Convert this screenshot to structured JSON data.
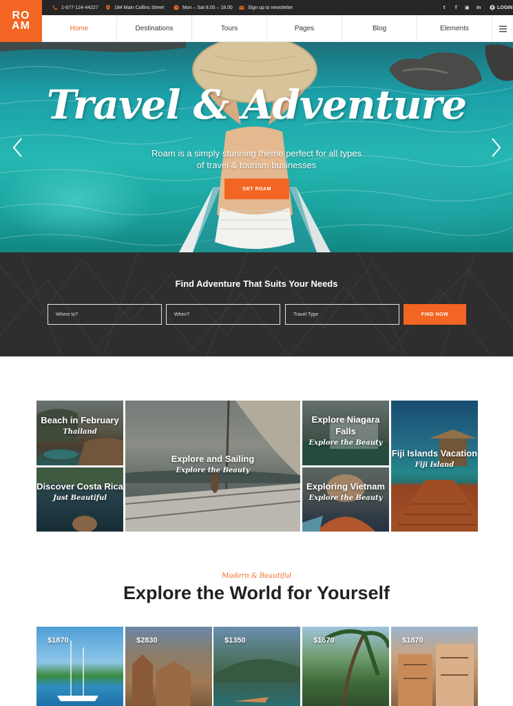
{
  "topbar": {
    "phone": "1-677-124-44227",
    "address": "184 Main Collins Street",
    "hours": "Mon – Sat 8.00 – 18.00",
    "newsletter": "Sign up to newsletter",
    "social": [
      "twitter-icon",
      "facebook-icon",
      "instagram-icon",
      "linkedin-icon"
    ],
    "social_glyphs": [
      "t",
      "f",
      "▣",
      "in"
    ],
    "login": "LOGIN"
  },
  "logo": {
    "line1": "RO",
    "line2": "AM"
  },
  "nav": {
    "items": [
      "Home",
      "Destinations",
      "Tours",
      "Pages",
      "Blog",
      "Elements"
    ],
    "active": "Home"
  },
  "hero": {
    "title": "Travel & Adventure",
    "subtitle": "Roam is a simply stunning theme perfect for all types of travel & tourism businesses",
    "button": "GET ROAM"
  },
  "search": {
    "title": "Find Adventure That Suits Your Needs",
    "where_placeholder": "Where to?",
    "when_placeholder": "When?",
    "type_placeholder": "Travel Type",
    "button": "FIND NOW"
  },
  "destinations": [
    {
      "title": "Beach in February",
      "subtitle": "Thailand"
    },
    {
      "title": "Discover Costa Rica",
      "subtitle": "Just Beautiful"
    },
    {
      "title": "Explore and Sailing",
      "subtitle": "Explore the Beauty"
    },
    {
      "title": "Explore Niagara Falls",
      "subtitle": "Explore the Beauty"
    },
    {
      "title": "Exploring Vietnam",
      "subtitle": "Explore the Beauty"
    },
    {
      "title": "Fiji Islands Vacation",
      "subtitle": "Fiji Island"
    }
  ],
  "explore": {
    "kicker": "Modern & Beautiful",
    "heading": "Explore the World for Yourself"
  },
  "tours": [
    {
      "price": "$1870"
    },
    {
      "price": "$2830"
    },
    {
      "price": "$1350"
    },
    {
      "price": "$1670"
    },
    {
      "price": "$1870"
    }
  ],
  "colors": {
    "accent": "#f26522",
    "dark": "#2e2e2e",
    "topbar": "#262626"
  }
}
